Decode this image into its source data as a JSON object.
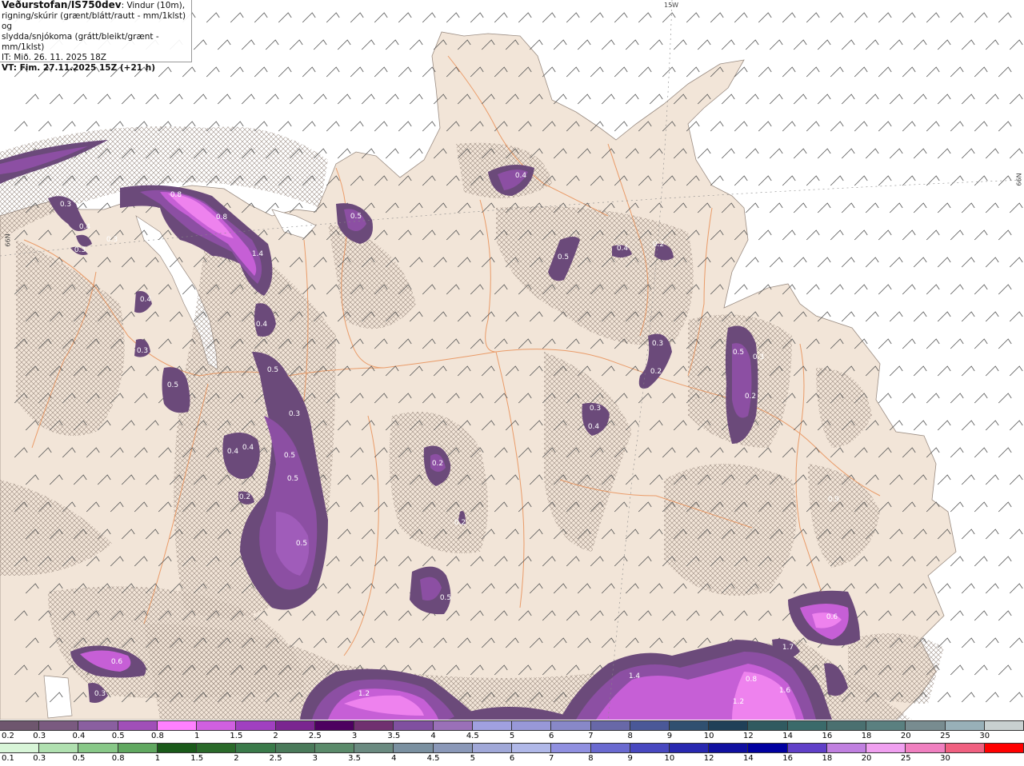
{
  "header": {
    "source": "Veðurstofan/IS750dev",
    "description_line1": ": Vindur (10m),",
    "description_line2": "rigning/skúrir (grænt/blátt/rautt - mm/1klst) og",
    "description_line3": "slydda/snjókoma (grátt/bleikt/grænt - mm/1klst)",
    "issue_time": "IT: Mið. 26. 11. 2025 18Z",
    "valid_time": "VT: Fim. 27.11.2025 15Z (+21 h)"
  },
  "grid_labels": {
    "top_lon": "15W",
    "left_lat": "66N",
    "right_lat": "66N"
  },
  "colors": {
    "sea": "#ffffff",
    "land": "#f2e5d8",
    "roads": "#e8894d",
    "precip_light": "#6b4a7a",
    "precip_mid": "#8c4fa3",
    "precip_strong": "#c65fd6",
    "precip_peak": "#ee82ee"
  },
  "precip_labels": [
    {
      "text": "0.3"
    },
    {
      "text": "0.4"
    },
    {
      "text": "0.3"
    },
    {
      "text": "0.3"
    },
    {
      "text": "0.8"
    },
    {
      "text": "0.8"
    },
    {
      "text": "1.4"
    },
    {
      "text": "0.4"
    },
    {
      "text": "0.3"
    },
    {
      "text": "0.5"
    },
    {
      "text": "0.4"
    },
    {
      "text": "0.5"
    },
    {
      "text": "0.3"
    },
    {
      "text": "0.4"
    },
    {
      "text": "0.4"
    },
    {
      "text": "0.5"
    },
    {
      "text": "0.5"
    },
    {
      "text": "0.2"
    },
    {
      "text": "0.5"
    },
    {
      "text": "0.5"
    },
    {
      "text": "0.6"
    },
    {
      "text": "0.3"
    },
    {
      "text": "0.4"
    },
    {
      "text": "0.5"
    },
    {
      "text": "0.4"
    },
    {
      "text": "0.2"
    },
    {
      "text": "0.3"
    },
    {
      "text": "0.2"
    },
    {
      "text": "0.3"
    },
    {
      "text": "0.4"
    },
    {
      "text": "0.2"
    },
    {
      "text": "0.2"
    },
    {
      "text": "0.5"
    },
    {
      "text": "0.3"
    },
    {
      "text": "0.5"
    },
    {
      "text": "0.2"
    },
    {
      "text": "0.9"
    },
    {
      "text": "0.6"
    },
    {
      "text": "1.7"
    },
    {
      "text": "1.4"
    },
    {
      "text": "0.8"
    },
    {
      "text": "1.6"
    },
    {
      "text": "1.2"
    },
    {
      "text": "1.2"
    }
  ],
  "legend_snow": {
    "colors": [
      "#6e566e",
      "#7a5a80",
      "#8a5fa0",
      "#a04fb8",
      "#ff80ff",
      "#d060e0",
      "#a040c0",
      "#7a2590",
      "#4d0060",
      "#703070",
      "#8050a0",
      "#9a70b8",
      "#a0a0e0",
      "#9898d8",
      "#8888c8",
      "#6868a8",
      "#4a5898",
      "#305070",
      "#204058",
      "#305a60",
      "#3a6a6a",
      "#4a7070",
      "#5a8080",
      "#788c90",
      "#98b0b8",
      "#c8d0d0"
    ],
    "labels": [
      "0.2",
      "0.3",
      "0.4",
      "0.5",
      "0.8",
      "1",
      "1.5",
      "2",
      "2.5",
      "3",
      "3.5",
      "4",
      "4.5",
      "5",
      "6",
      "7",
      "8",
      "9",
      "10",
      "12",
      "14",
      "16",
      "18",
      "20",
      "25",
      "30"
    ]
  },
  "legend_rain": {
    "colors": [
      "#d8f5d8",
      "#b0e0b0",
      "#88c888",
      "#60a860",
      "#1a5a1a",
      "#2a6a2a",
      "#3a7a4a",
      "#4a7a5a",
      "#5a8a6a",
      "#6a8a80",
      "#7a90a0",
      "#8a98b8",
      "#a0a8d8",
      "#b0b8e8",
      "#9090e0",
      "#6a6ad0",
      "#4848c0",
      "#2828b0",
      "#1010a0",
      "#0000a0",
      "#6040c8",
      "#c080e0",
      "#f0a0f0",
      "#f080c0",
      "#f06080",
      "#ff0000"
    ],
    "labels": [
      "0.1",
      "0.3",
      "0.5",
      "0.8",
      "1",
      "1.5",
      "2",
      "2.5",
      "3",
      "3.5",
      "4",
      "4.5",
      "5",
      "6",
      "7",
      "8",
      "9",
      "10",
      "12",
      "14",
      "16",
      "18",
      "20",
      "25",
      "30"
    ]
  }
}
